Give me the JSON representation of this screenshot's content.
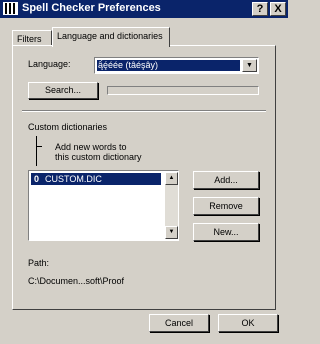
{
  "window": {
    "title": "Spell Checker Preferences",
    "help_glyph": "?",
    "close_glyph": "X"
  },
  "tabs": [
    {
      "label": "Filters"
    },
    {
      "label": "Language and dictionaries"
    }
  ],
  "language": {
    "label": "Language:",
    "value": "ą̂̀ȩ́éée (tâéşây)",
    "dropdown_glyph": "▼"
  },
  "search_button": "Search...",
  "custom_dictionaries": {
    "section_label": "Custom dictionaries",
    "add_words_label": "Add new words to\nthis custom dictionary",
    "items": [
      {
        "index": "0",
        "name": "CUSTOM.DIC"
      }
    ],
    "scroll_up": "▲",
    "scroll_down": "▼"
  },
  "buttons": {
    "add": "Add...",
    "remove": "Remove",
    "new": "New..."
  },
  "path": {
    "label": "Path:",
    "value": "C:\\Documen...soft\\Proof"
  },
  "footer": {
    "cancel": "Cancel",
    "ok": "OK"
  },
  "colors": {
    "titlebar": "#0a246a",
    "selection": "#0a246a",
    "face": "#d4d0c8"
  }
}
